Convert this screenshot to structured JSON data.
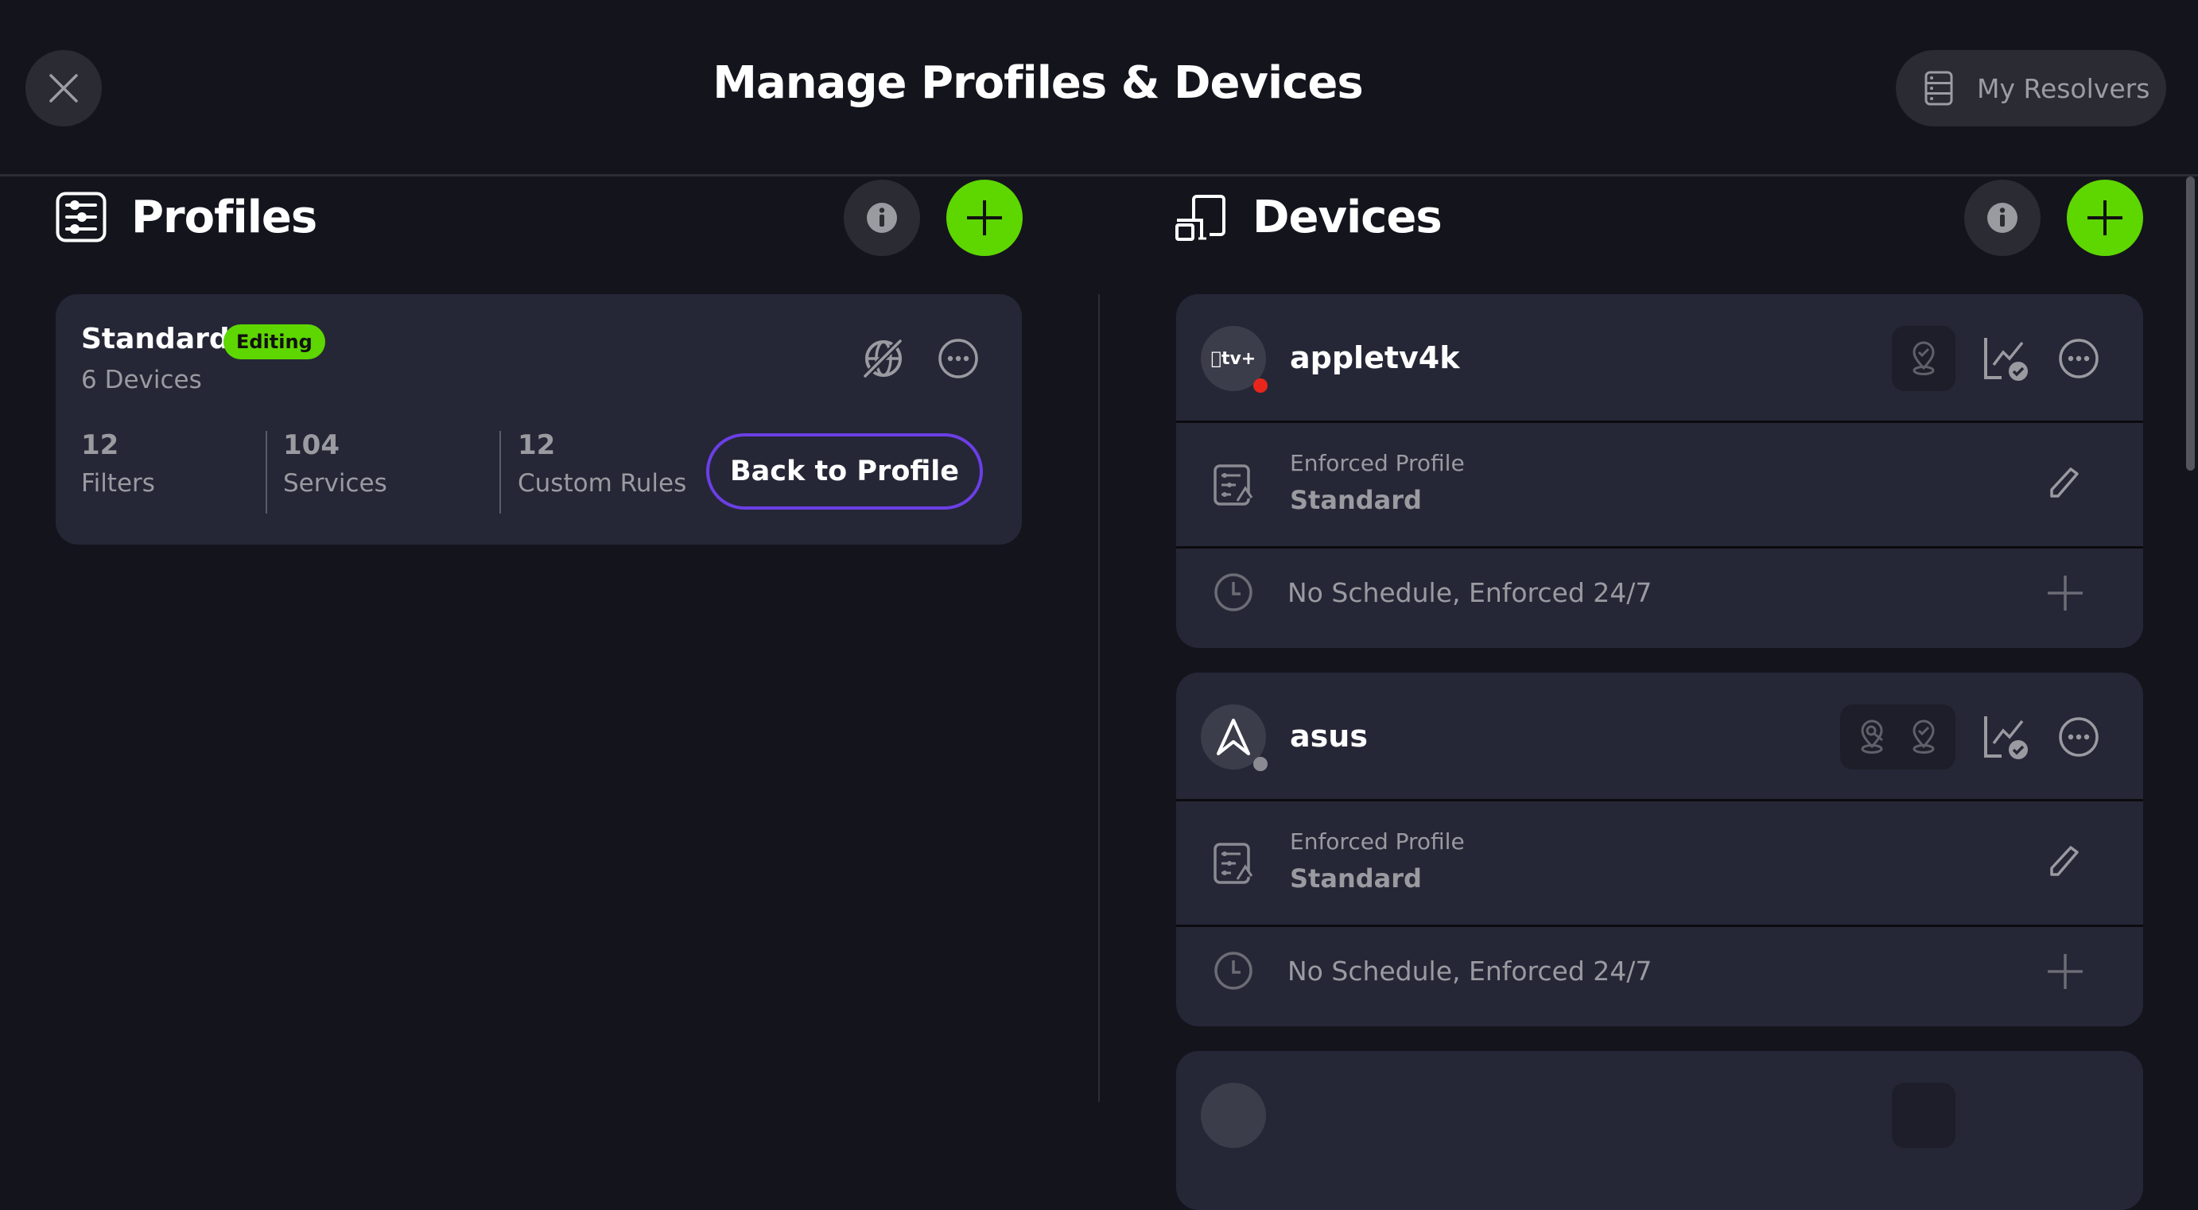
{
  "header": {
    "title": "Manage Profiles & Devices",
    "close_icon": "close-icon",
    "resolvers_label": "My Resolvers",
    "resolvers_icon": "server-stack-icon"
  },
  "profiles": {
    "title": "Profiles",
    "icon": "sliders-icon",
    "info_icon": "info-icon",
    "add_icon": "plus-icon",
    "items": [
      {
        "name": "Standard",
        "badge": "Editing",
        "subtitle": "6 Devices",
        "stats": [
          {
            "value": "12",
            "label": "Filters"
          },
          {
            "value": "104",
            "label": "Services"
          },
          {
            "value": "12",
            "label": "Custom Rules"
          }
        ],
        "action_label": "Back to Profile",
        "icons": [
          "globe-disabled-icon",
          "more-icon"
        ]
      }
    ]
  },
  "devices": {
    "title": "Devices",
    "icon": "devices-icon",
    "info_icon": "info-icon",
    "add_icon": "plus-icon",
    "items": [
      {
        "name": "appletv4k",
        "avatar_text": "tv+",
        "avatar_icon": "apple-tv-icon",
        "status": "offline",
        "status_color": "#e8261c",
        "location_icons": [
          "location-check-icon"
        ],
        "enforced_label": "Enforced Profile",
        "enforced_value": "Standard",
        "schedule_text": "No Schedule, Enforced 24/7"
      },
      {
        "name": "asus",
        "avatar_icon": "asus-logo-icon",
        "status": "unknown",
        "status_color": "#8a8a92",
        "location_icons": [
          "location-search-icon",
          "location-check-icon"
        ],
        "enforced_label": "Enforced Profile",
        "enforced_value": "Standard",
        "schedule_text": "No Schedule, Enforced 24/7"
      }
    ]
  },
  "colors": {
    "background": "#14141d",
    "card": "#252736",
    "accent_green": "#5ed600",
    "accent_purple": "#6b3fe6",
    "muted_text": "#9a9aa1"
  }
}
